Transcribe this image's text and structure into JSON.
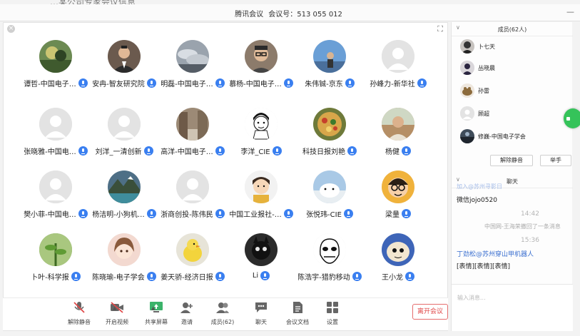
{
  "cutoff_text": "…某公司专家会议信息",
  "window": {
    "app_name": "腾讯会议",
    "meeting_label": "会议号：",
    "meeting_id": "513 055 012",
    "minimize_glyph": "—"
  },
  "main": {
    "close_glyph": "×",
    "fullscreen_glyph": "⛶"
  },
  "participants": [
    {
      "name": "谭哲-中国电子…",
      "avatar": "landscape-green"
    },
    {
      "name": "安冉-智友研究院",
      "avatar": "man-suit"
    },
    {
      "name": "明磊-中国电子…",
      "avatar": "clouds"
    },
    {
      "name": "慕杨-中国电子…",
      "avatar": "man-glasses"
    },
    {
      "name": "朱伟铖-京东",
      "avatar": "sky-person"
    },
    {
      "name": "孙峰力-新华社",
      "avatar": "default"
    },
    {
      "name": "张晓雅-中国电…",
      "avatar": "default"
    },
    {
      "name": "刘洋_一清创新",
      "avatar": "default"
    },
    {
      "name": "高洋-中国电子…",
      "avatar": "street"
    },
    {
      "name": "李洋_CIE",
      "avatar": "cartoon-boy"
    },
    {
      "name": "科技日报刘艳",
      "avatar": "food"
    },
    {
      "name": "杨健",
      "avatar": "man-outdoor"
    },
    {
      "name": "樊小菲-中国电…",
      "avatar": "default"
    },
    {
      "name": "杨洁明-小狗机…",
      "avatar": "mountain-lake"
    },
    {
      "name": "浙商创投-陈伟民",
      "avatar": "default"
    },
    {
      "name": "中国工业报社-…",
      "avatar": "cartoon-girl"
    },
    {
      "name": "张悦玮-CIE",
      "avatar": "polar-bear"
    },
    {
      "name": "梁量",
      "avatar": "cartoon-glasses"
    },
    {
      "name": "卜叶-科学报",
      "avatar": "plant"
    },
    {
      "name": "陈晓瑜-电子学会",
      "avatar": "anime-girl"
    },
    {
      "name": "姜天骄-经济日报",
      "avatar": "yellow-bird"
    },
    {
      "name": "Li",
      "avatar": "dark-toy"
    },
    {
      "name": "陈浩宇-猎豹移动",
      "avatar": "meme-face"
    },
    {
      "name": "王小龙",
      "avatar": "blue-toy"
    }
  ],
  "toolbar": {
    "items": [
      {
        "label": "解除静音",
        "icon": "mic-muted-icon"
      },
      {
        "label": "开启视频",
        "icon": "camera-off-icon"
      },
      {
        "label": "共享屏幕",
        "icon": "share-screen-icon"
      },
      {
        "label": "邀请",
        "icon": "invite-icon"
      },
      {
        "label": "成员(62)",
        "icon": "members-icon"
      },
      {
        "label": "聊天",
        "icon": "chat-icon"
      },
      {
        "label": "会议文档",
        "icon": "document-icon"
      },
      {
        "label": "设置",
        "icon": "settings-icon"
      }
    ],
    "caret": "▲",
    "leave_label": "离开会议"
  },
  "members_panel": {
    "title": "成员(62人)",
    "chevron": "∨",
    "members": [
      {
        "name": "卜七天",
        "avatar": "person-dark"
      },
      {
        "name": "丛晓晨",
        "avatar": "silhouette"
      },
      {
        "name": "孙雷",
        "avatar": "creature"
      },
      {
        "name": "顾超",
        "avatar": "default"
      },
      {
        "name": "修巍-中国电子学会",
        "avatar": "sky-dark"
      }
    ],
    "unmute_all_label": "解除静音",
    "raise_hand_label": "举手"
  },
  "chat_panel": {
    "title": "聊天",
    "chevron": "∨",
    "top_cut": "加入@苏州寻影日",
    "line1": "微信jojo0520",
    "time1": "14:42",
    "system_msg": "中国网-王海荣撤回了一条消息",
    "time2": "15:36",
    "sender": "丁劲松@苏州穿山甲机器人",
    "line2": "[表情][表情][表情]",
    "input_placeholder": "输入消息..."
  },
  "colors": {
    "accent_blue": "#3a7ff0",
    "leave_red": "#e04848",
    "float_green": "#35c35a"
  }
}
